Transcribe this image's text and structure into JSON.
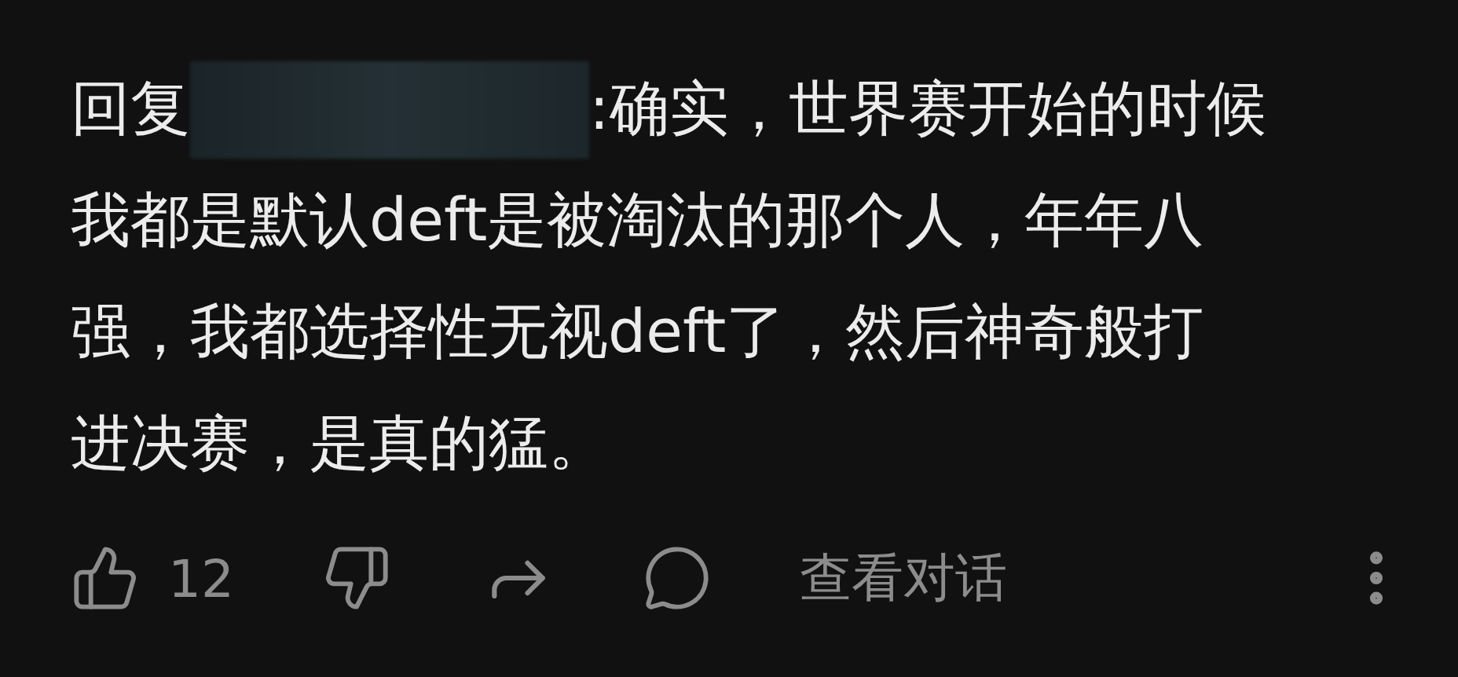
{
  "comment": {
    "reply_prefix": "回复",
    "lines": [
      ":确实，世界赛开始的时候",
      "我都是默认deft是被淘汰的那个人，年年八",
      "强，我都选择性无视deft了，然后神奇般打",
      "进决赛，是真的猛。"
    ]
  },
  "actions": {
    "like_count": "12",
    "view_conversation": "查看对话"
  }
}
